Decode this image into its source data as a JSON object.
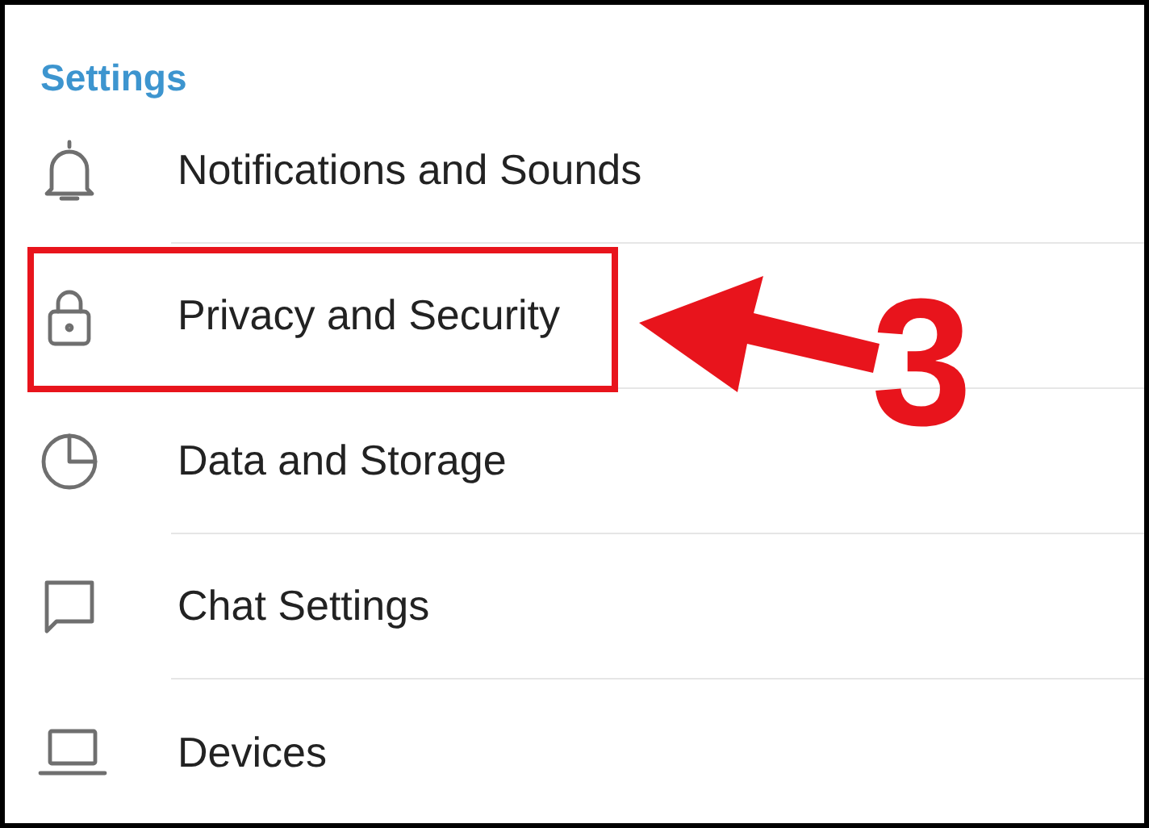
{
  "header": {
    "title": "Settings"
  },
  "items": [
    {
      "label": "Notifications and Sounds",
      "highlighted": false
    },
    {
      "label": "Privacy and Security",
      "highlighted": true
    },
    {
      "label": "Data and Storage",
      "highlighted": false
    },
    {
      "label": "Chat Settings",
      "highlighted": false
    },
    {
      "label": "Devices",
      "highlighted": false
    }
  ],
  "annotation": {
    "step": "3"
  }
}
